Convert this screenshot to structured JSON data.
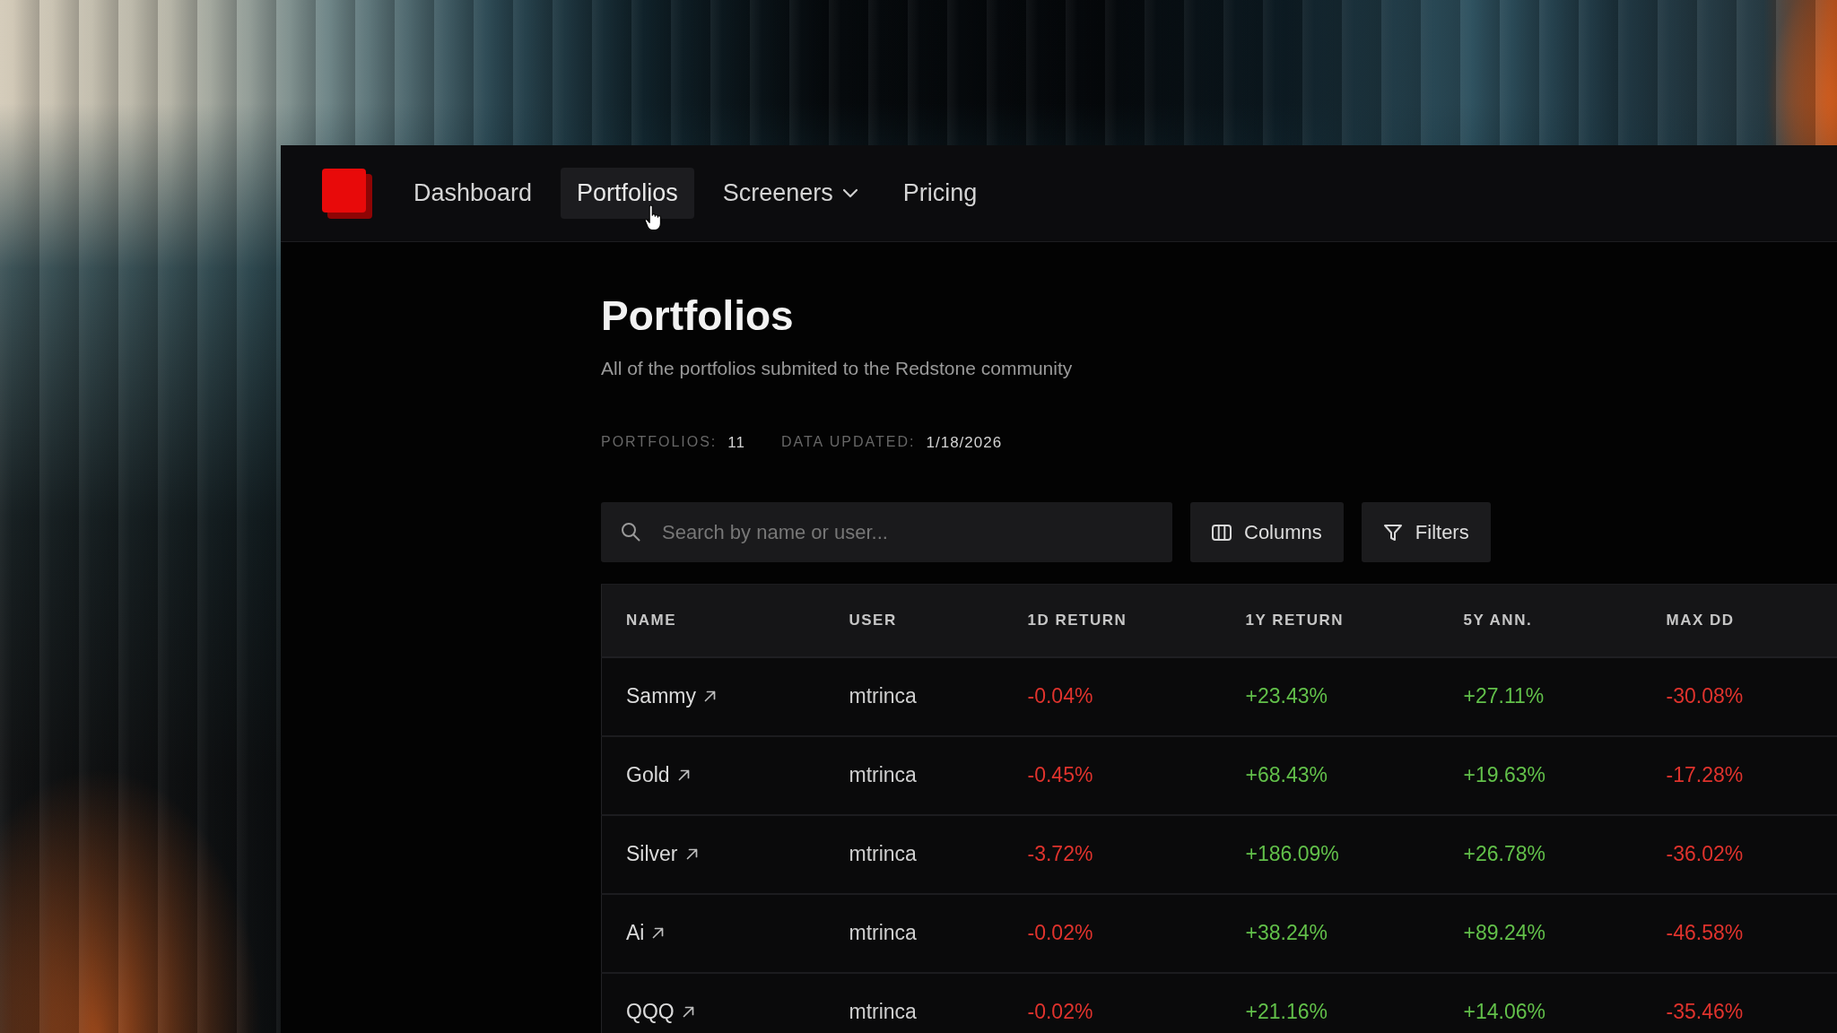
{
  "navbar": {
    "items": [
      {
        "label": "Dashboard",
        "kind": "link",
        "selected": false
      },
      {
        "label": "Portfolios",
        "kind": "link",
        "selected": true
      },
      {
        "label": "Screeners",
        "kind": "dropdown",
        "selected": false
      },
      {
        "label": "Pricing",
        "kind": "link",
        "selected": false
      }
    ]
  },
  "header": {
    "title": "Portfolios",
    "subtitle": "All of the portfolios submited to the Redstone community",
    "stats": [
      {
        "label": "PORTFOLIOS:",
        "value": "11"
      },
      {
        "label": "DATA UPDATED:",
        "value": "1/18/2026"
      }
    ]
  },
  "toolbar": {
    "search": {
      "placeholder": "Search by name or user..."
    },
    "buttons": [
      {
        "label": "Columns",
        "kind": "columns"
      },
      {
        "label": "Filters",
        "kind": "filters"
      }
    ]
  },
  "table": {
    "columns": [
      "NAME",
      "USER",
      "1D RETURN",
      "1Y RETURN",
      "5Y ANN.",
      "MAX DD"
    ],
    "rows": [
      {
        "name": "Sammy",
        "user": "mtrinca",
        "values": [
          {
            "text": "-0.04%",
            "color": "#e0332d"
          },
          {
            "text": "+23.43%",
            "color": "#62c04a"
          },
          {
            "text": "+27.11%",
            "color": "#62c04a"
          },
          {
            "text": "-30.08%",
            "color": "#e0332d"
          }
        ]
      },
      {
        "name": "Gold",
        "user": "mtrinca",
        "values": [
          {
            "text": "-0.45%",
            "color": "#e0332d"
          },
          {
            "text": "+68.43%",
            "color": "#62c04a"
          },
          {
            "text": "+19.63%",
            "color": "#62c04a"
          },
          {
            "text": "-17.28%",
            "color": "#e0332d"
          }
        ]
      },
      {
        "name": "Silver",
        "user": "mtrinca",
        "values": [
          {
            "text": "-3.72%",
            "color": "#e0332d"
          },
          {
            "text": "+186.09%",
            "color": "#62c04a"
          },
          {
            "text": "+26.78%",
            "color": "#62c04a"
          },
          {
            "text": "-36.02%",
            "color": "#e0332d"
          }
        ]
      },
      {
        "name": "Ai",
        "user": "mtrinca",
        "values": [
          {
            "text": "-0.02%",
            "color": "#e0332d"
          },
          {
            "text": "+38.24%",
            "color": "#62c04a"
          },
          {
            "text": "+89.24%",
            "color": "#62c04a"
          },
          {
            "text": "-46.58%",
            "color": "#e0332d"
          }
        ]
      },
      {
        "name": "QQQ",
        "user": "mtrinca",
        "values": [
          {
            "text": "-0.02%",
            "color": "#e0332d"
          },
          {
            "text": "+21.16%",
            "color": "#62c04a"
          },
          {
            "text": "+14.06%",
            "color": "#62c04a"
          },
          {
            "text": "-35.46%",
            "color": "#e0332d"
          }
        ]
      }
    ]
  }
}
